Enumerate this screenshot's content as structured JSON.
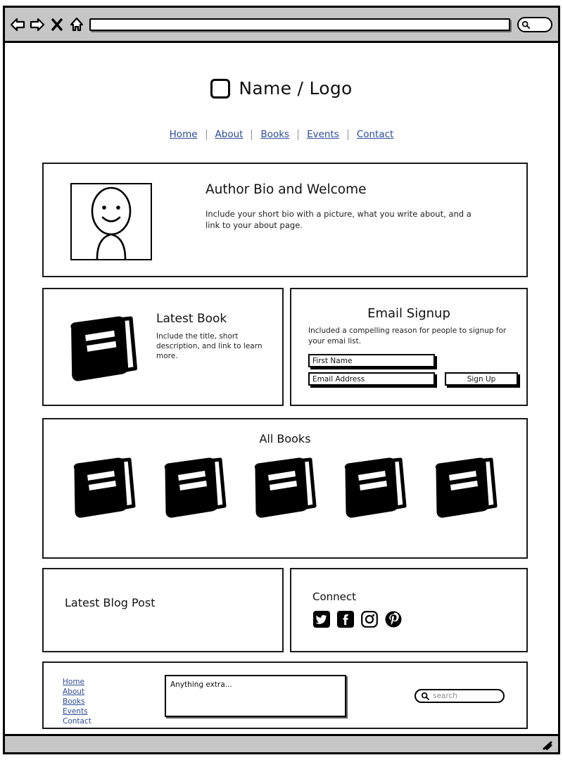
{
  "browser": {
    "back_icon": "back-arrow-icon",
    "forward_icon": "forward-arrow-icon",
    "stop_icon": "close-x-icon",
    "home_icon": "home-icon",
    "url_value": "",
    "url_placeholder": "",
    "toolbar_search_icon": "search-icon",
    "resize_grip_icon": "resize-grip-icon"
  },
  "header": {
    "logo_icon": "logo-square-icon",
    "logo_text": "Name / Logo"
  },
  "nav": {
    "items": [
      {
        "label": "Home"
      },
      {
        "label": "About"
      },
      {
        "label": "Books"
      },
      {
        "label": "Events"
      },
      {
        "label": "Contact"
      }
    ]
  },
  "bio": {
    "photo_icon": "author-portrait-icon",
    "heading": "Author Bio and Welcome",
    "body": "Include your short bio with a picture, what you write about, and a link to your about page."
  },
  "latest_book": {
    "icon": "book-icon",
    "heading": "Latest Book",
    "body": "Include the title, short description, and link to learn more."
  },
  "email_signup": {
    "heading": "Email Signup",
    "body": "Included a compelling reason for people to signup for your emai list.",
    "first_name_placeholder": "First Name",
    "first_name_value": "",
    "email_placeholder": "Email Address",
    "email_value": "",
    "submit_label": "Sign Up"
  },
  "all_books": {
    "heading": "All Books",
    "book_icon": "book-icon",
    "count": 5
  },
  "blog": {
    "heading": "Latest Blog Post"
  },
  "connect": {
    "heading": "Connect",
    "socials": [
      {
        "name": "twitter-icon"
      },
      {
        "name": "facebook-icon"
      },
      {
        "name": "instagram-icon"
      },
      {
        "name": "pinterest-icon"
      }
    ]
  },
  "footer": {
    "links": [
      {
        "label": "Home",
        "underlined": true
      },
      {
        "label": "About",
        "underlined": true
      },
      {
        "label": "Books",
        "underlined": true
      },
      {
        "label": "Events",
        "underlined": true
      },
      {
        "label": "Contact",
        "underlined": false
      }
    ],
    "note_text": "Anything extra...",
    "search_icon": "search-icon",
    "search_placeholder": "search",
    "search_value": ""
  },
  "colors": {
    "link": "#2a4b9b",
    "ink": "#111111",
    "chrome": "#c6c6c6",
    "placeholder": "#8d8d8d"
  }
}
